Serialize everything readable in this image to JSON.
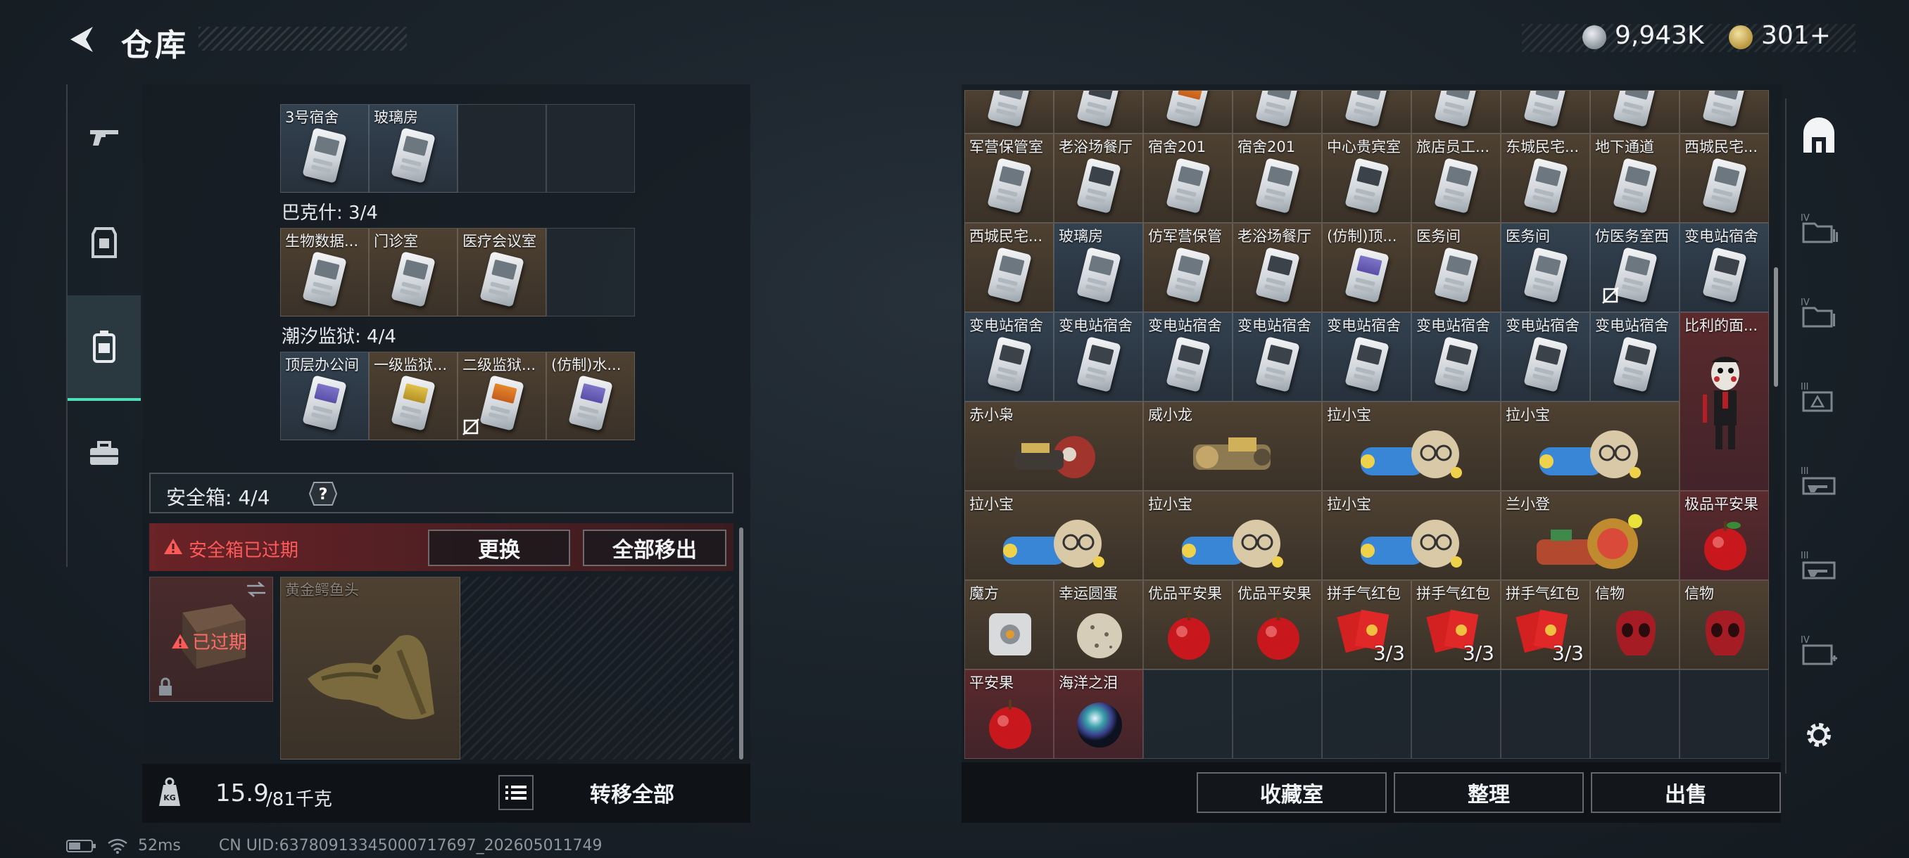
{
  "header": {
    "title": "仓库",
    "currency": [
      {
        "icon": "silver-coin-icon",
        "value": "9,943K"
      },
      {
        "icon": "gold-coin-icon",
        "value": "301+"
      }
    ]
  },
  "left_nav": [
    {
      "icon": "gun-icon"
    },
    {
      "icon": "armor-icon"
    },
    {
      "icon": "backpack-icon",
      "active": true
    },
    {
      "icon": "toolbox-icon"
    }
  ],
  "key_groups": [
    {
      "label": "",
      "cells": [
        "3号宿舍",
        "玻璃房",
        "",
        ""
      ],
      "colors": [
        "blue",
        "blue",
        "empty",
        "empty"
      ]
    },
    {
      "label": "巴克什: 3/4",
      "cells": [
        "生物数据...",
        "门诊室",
        "医疗会议室",
        ""
      ],
      "colors": [
        "brown",
        "brown",
        "brown",
        "empty"
      ]
    },
    {
      "label": "潮汐监狱: 4/4",
      "cells": [
        "顶层办公间",
        "一级监狱...",
        "二级监狱...",
        "(仿制)水..."
      ],
      "colors": [
        "blue",
        "brown",
        "brown",
        "brown"
      ]
    }
  ],
  "safe": {
    "title": "安全箱: 4/4",
    "expired_text": "安全箱已过期",
    "replace_label": "更换",
    "move_all_label": "全部移出",
    "expired_badge": "已过期",
    "item_name": "黄金鳄鱼头"
  },
  "bottom_left": {
    "weight": "15.9",
    "capacity": "/81千克",
    "transfer_label": "转移全部"
  },
  "right_grid": {
    "row0": [
      "",
      "",
      "",
      "",
      "",
      "",
      "",
      "",
      ""
    ],
    "row1": [
      "军营保管室",
      "老浴场餐厅",
      "宿舍201",
      "宿舍201",
      "中心贵宾室",
      "旅店员工...",
      "东城民宅...",
      "地下通道",
      "西城民宅..."
    ],
    "row2": [
      "西城民宅...",
      "玻璃房",
      "仿军营保管",
      "老浴场餐厅",
      "(仿制)顶...",
      "医务间",
      "医务间",
      "仿医务室西",
      "变电站宿舍"
    ],
    "row3": [
      "变电站宿舍",
      "变电站宿舍",
      "变电站宿舍",
      "变电站宿舍",
      "变电站宿舍",
      "变电站宿舍",
      "变电站宿舍",
      "变电站宿舍"
    ],
    "tall_item": "比利的面...",
    "row4": [
      "赤小枭",
      "威小龙",
      "拉小宝",
      "拉小宝"
    ],
    "row5": [
      "拉小宝",
      "拉小宝",
      "拉小宝",
      "兰小登",
      "极品平安果"
    ],
    "row6": [
      {
        "name": "魔方",
        "count": ""
      },
      {
        "name": "幸运圆蛋",
        "count": ""
      },
      {
        "name": "优品平安果",
        "count": ""
      },
      {
        "name": "优品平安果",
        "count": ""
      },
      {
        "name": "拼手气红包",
        "count": "3/3"
      },
      {
        "name": "拼手气红包",
        "count": "3/3"
      },
      {
        "name": "拼手气红包",
        "count": "3/3"
      },
      {
        "name": "信物",
        "count": ""
      },
      {
        "name": "信物",
        "count": ""
      }
    ],
    "row7": [
      "平安果",
      "海洋之泪"
    ]
  },
  "right_actions": {
    "collection_label": "收藏室",
    "sort_label": "整理",
    "sell_label": "出售"
  },
  "right_nav": [
    "shelter-icon",
    "folder-iv-icon",
    "folder-iv-icon",
    "case-iii-icon",
    "gun-case-iii-icon",
    "gun-case-iii-icon",
    "medkit-iv-icon"
  ],
  "status": {
    "ping": "52ms",
    "uid": "CN UID:63780913345000717697_202605011749"
  },
  "colors": {
    "accent_green": "#4fe0b8",
    "expired_red": "#ff5a5a"
  }
}
